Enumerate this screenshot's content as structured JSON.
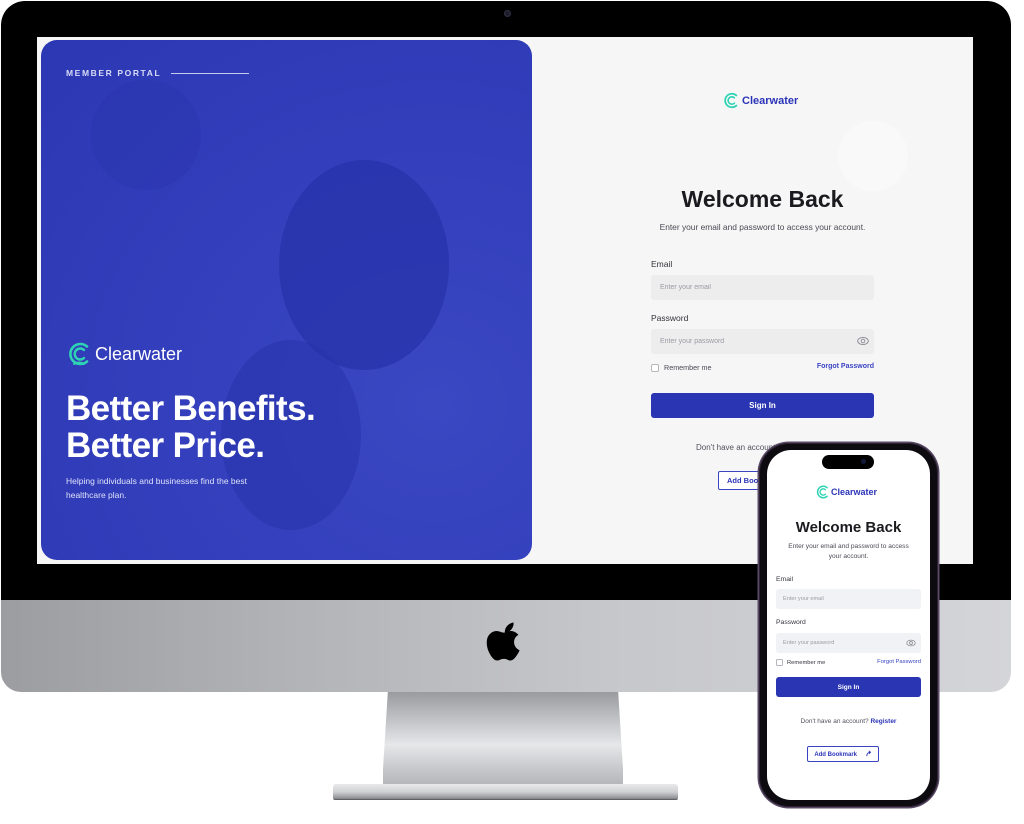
{
  "brand": {
    "name": "Clearwater",
    "primary_color": "#2a35b4",
    "accent_color": "#2ed3b4",
    "hero_color": "#3440bd"
  },
  "desktop": {
    "hero": {
      "eyebrow": "MEMBER PORTAL",
      "brand_name": "Clearwater",
      "headline_line1": "Better Benefits.",
      "headline_line2": "Better Price.",
      "subtext": "Helping individuals and businesses find the best healthcare plan."
    },
    "login": {
      "logo_name": "Clearwater",
      "title": "Welcome Back",
      "subtitle": "Enter your email and password to access your account.",
      "email_label": "Email",
      "email_placeholder": "Enter your email",
      "email_value": "",
      "password_label": "Password",
      "password_placeholder": "Enter your password",
      "password_value": "",
      "password_toggle_icon": "eye-icon",
      "remember_label": "Remember me",
      "remember_checked": false,
      "forgot_label": "Forgot Password",
      "signin_label": "Sign In",
      "register_prompt": "Don't have an account?",
      "bookmark_label": "Add Bookmark"
    }
  },
  "mobile": {
    "logo_name": "Clearwater",
    "title": "Welcome Back",
    "subtitle": "Enter your email and password to access your account.",
    "email_label": "Email",
    "email_placeholder": "Enter your email",
    "password_label": "Password",
    "password_placeholder": "Enter your password",
    "password_toggle_icon": "eye-icon",
    "remember_label": "Remember me",
    "forgot_label": "Forgot Password",
    "signin_label": "Sign In",
    "register_prompt": "Don't have an account?",
    "register_link": "Register",
    "bookmark_label": "Add Bookmark",
    "bookmark_icon": "share-arrow-icon"
  }
}
